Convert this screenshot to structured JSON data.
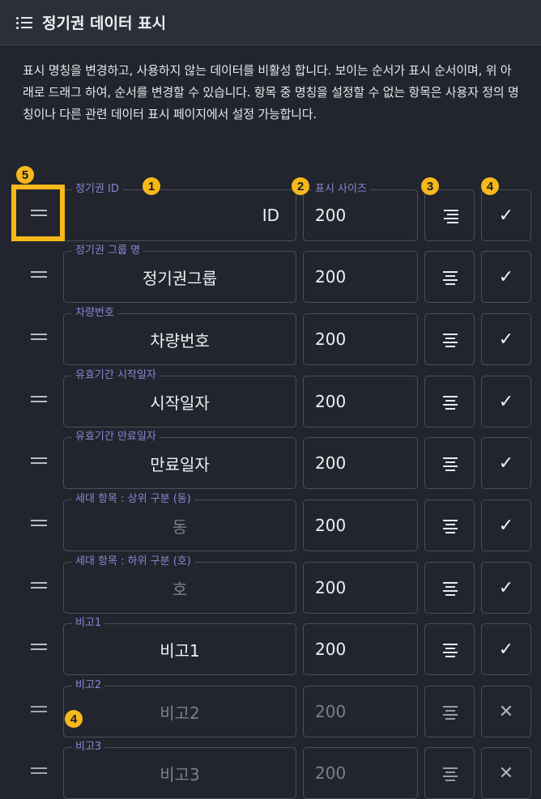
{
  "header": {
    "title": "정기권 데이터 표시",
    "icon": "list-icon"
  },
  "description": "표시 명칭을 변경하고, 사용하지 않는 데이터를 비활성 합니다. 보이는 순서가 표시 순서이며, 위 아래로 드래그 하여, 순서를 변경할 수 있습니다. 항목 중 명칭을 설정할 수 없는 항목은 사용자 정의 명칭이나 다른 관련 데이터 표시 페이지에서 설정 가능합니다.",
  "size_label": "표시 사이즈",
  "badges": {
    "b1": "1",
    "b2": "2",
    "b3": "3",
    "b4": "4",
    "b5": "5",
    "b4b": "4"
  },
  "rows": [
    {
      "label": "정기권 ID",
      "value": "ID",
      "size": "200",
      "enabled": true,
      "checkmark": "✓"
    },
    {
      "label": "정기권 그룹 명",
      "value": "정기권그룹",
      "size": "200",
      "enabled": true,
      "checkmark": "✓"
    },
    {
      "label": "차량번호",
      "value": "차량번호",
      "size": "200",
      "enabled": true,
      "checkmark": "✓"
    },
    {
      "label": "유효기간 시작일자",
      "value": "시작일자",
      "size": "200",
      "enabled": true,
      "checkmark": "✓"
    },
    {
      "label": "유효기간 만료일자",
      "value": "만료일자",
      "size": "200",
      "enabled": true,
      "checkmark": "✓"
    },
    {
      "label": "세대 항목 : 상위 구분 (동)",
      "value": "동",
      "size": "200",
      "enabled": true,
      "checkmark": "✓"
    },
    {
      "label": "세대 항목 : 하위 구분 (호)",
      "value": "호",
      "size": "200",
      "enabled": true,
      "checkmark": "✓"
    },
    {
      "label": "비고1",
      "value": "비고1",
      "size": "200",
      "enabled": true,
      "checkmark": "✓"
    },
    {
      "label": "비고2",
      "value": "비고2",
      "size": "200",
      "enabled": false,
      "checkmark": "✕"
    },
    {
      "label": "비고3",
      "value": "비고3",
      "size": "200",
      "enabled": false,
      "checkmark": "✕"
    }
  ],
  "colors": {
    "accent": "#f6b81a",
    "label": "#8a86d6",
    "background": "#22252d"
  }
}
